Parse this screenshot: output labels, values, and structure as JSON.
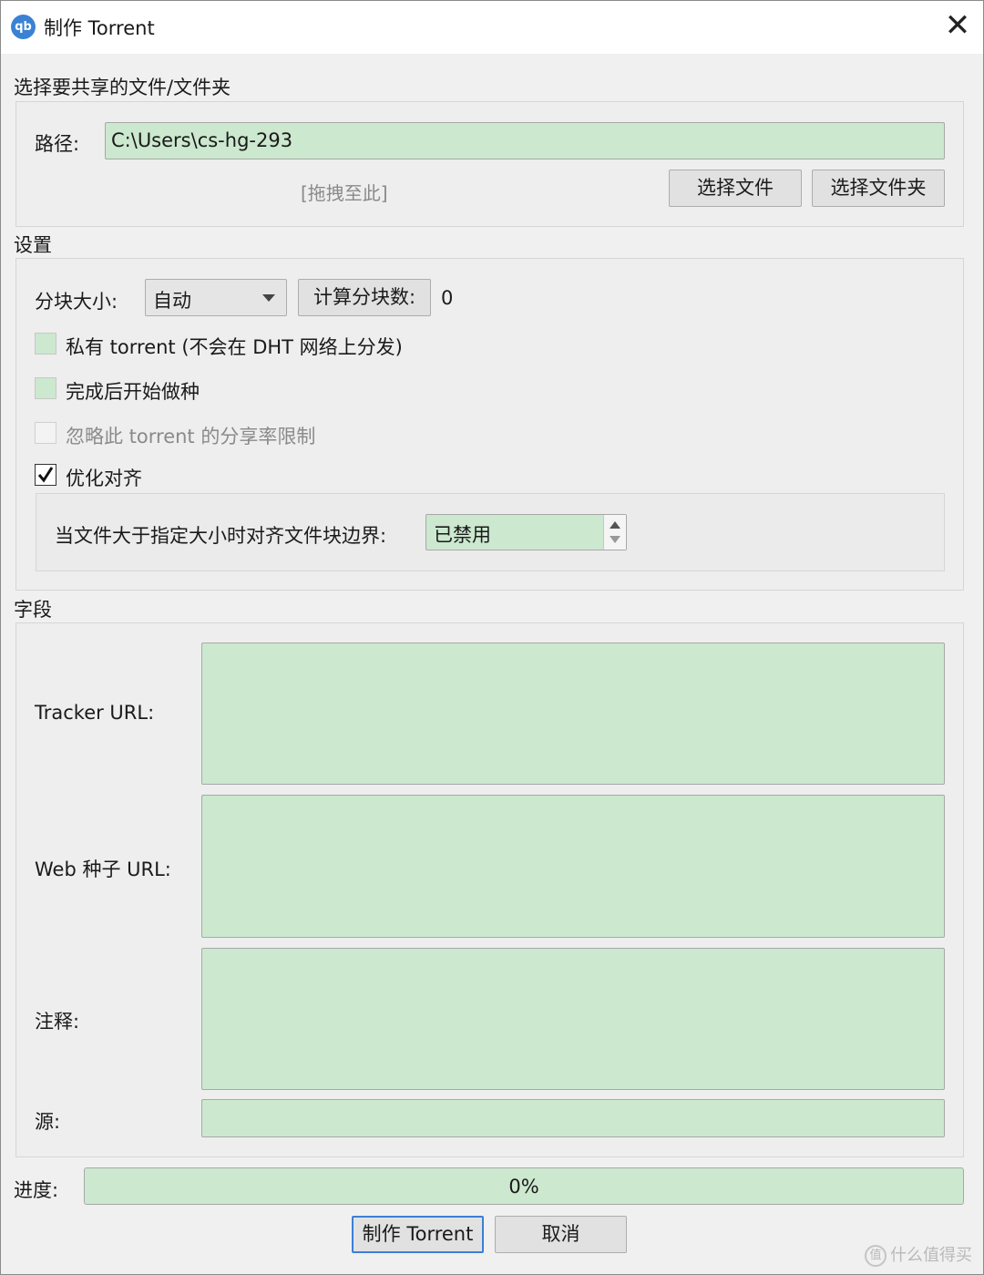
{
  "window": {
    "title": "制作 Torrent",
    "app_icon_text": "qb",
    "close_glyph": "✕"
  },
  "file_section": {
    "heading": "选择要共享的文件/文件夹",
    "path_label": "路径:",
    "path_value": "C:\\Users\\cs-hg-293",
    "drop_hint": "[拖拽至此]",
    "select_file_button": "选择文件",
    "select_folder_button": "选择文件夹"
  },
  "settings": {
    "heading": "设置",
    "piece_size_label": "分块大小:",
    "piece_size_value": "自动",
    "calc_pieces_button": "计算分块数:",
    "piece_count": "0",
    "private_label": "私有 torrent (不会在 DHT 网络上分发)",
    "start_seeding_label": "完成后开始做种",
    "ignore_ratio_label": "忽略此 torrent 的分享率限制",
    "optimize_alignment_label": "优化对齐",
    "align_threshold_label": "当文件大于指定大小时对齐文件块边界:",
    "align_threshold_value": "已禁用"
  },
  "fields": {
    "heading": "字段",
    "tracker_url_label": "Tracker URL:",
    "web_seed_url_label": "Web 种子 URL:",
    "comment_label": "注释:",
    "source_label": "源:"
  },
  "progress": {
    "label": "进度:",
    "value_text": "0%",
    "fraction": 0
  },
  "actions": {
    "create_button": "制作 Torrent",
    "cancel_button": "取消"
  },
  "watermark": {
    "text": "什么值得买",
    "icon_text": "值"
  },
  "colors": {
    "field_green": "#cce8cf",
    "dialog_bg": "#f0f0f0",
    "focus_blue": "#3c7fd6"
  }
}
